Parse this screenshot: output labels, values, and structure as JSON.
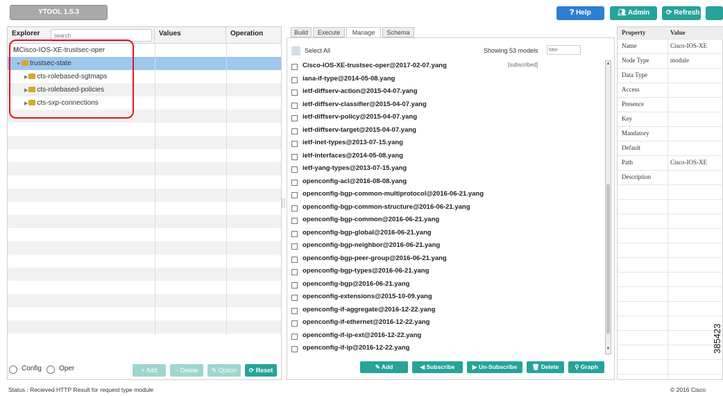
{
  "app": {
    "title": "YTOOL 1.5.3"
  },
  "toolbar": {
    "help": "Help",
    "admin": "Admin",
    "refresh": "Refresh"
  },
  "explorer": {
    "header": {
      "explorer": "Explorer",
      "search_placeholder": "search",
      "values": "Values",
      "operation": "Operation"
    },
    "tree": [
      {
        "label": "Cisco-IOS-XE-trustsec-oper"
      },
      {
        "label": "trustsec-state"
      },
      {
        "label": "cts-rolebased-sgtmaps"
      },
      {
        "label": "cts-rolebased-policies"
      },
      {
        "label": "cts-sxp-connections"
      }
    ],
    "footer": {
      "config": "Config",
      "oper": "Oper",
      "add": "Add",
      "delete": "Delete",
      "option": "Option",
      "reset": "Reset"
    }
  },
  "tabs": [
    "Build",
    "Execute",
    "Manage",
    "Schema"
  ],
  "manage": {
    "select_all": "Select All",
    "showing": "Showing 53 models",
    "filter_placeholder": "filter",
    "models": [
      {
        "name": "Cisco-IOS-XE-trustsec-oper@2017-02-07.yang",
        "tag": "[subscribed]"
      },
      {
        "name": "iana-if-type@2014-05-08.yang"
      },
      {
        "name": "ietf-diffserv-action@2015-04-07.yang"
      },
      {
        "name": "ietf-diffserv-classifier@2015-04-07.yang"
      },
      {
        "name": "ietf-diffserv-policy@2015-04-07.yang"
      },
      {
        "name": "ietf-diffserv-target@2015-04-07.yang"
      },
      {
        "name": "ietf-inet-types@2013-07-15.yang"
      },
      {
        "name": "ietf-interfaces@2014-05-08.yang"
      },
      {
        "name": "ietf-yang-types@2013-07-15.yang"
      },
      {
        "name": "openconfig-acl@2016-08-08.yang"
      },
      {
        "name": "openconfig-bgp-common-multiprotocol@2016-06-21.yang"
      },
      {
        "name": "openconfig-bgp-common-structure@2016-06-21.yang"
      },
      {
        "name": "openconfig-bgp-common@2016-06-21.yang"
      },
      {
        "name": "openconfig-bgp-global@2016-06-21.yang"
      },
      {
        "name": "openconfig-bgp-neighbor@2016-06-21.yang"
      },
      {
        "name": "openconfig-bgp-peer-group@2016-06-21.yang"
      },
      {
        "name": "openconfig-bgp-types@2016-06-21.yang"
      },
      {
        "name": "openconfig-bgp@2016-06-21.yang"
      },
      {
        "name": "openconfig-extensions@2015-10-09.yang"
      },
      {
        "name": "openconfig-if-aggregate@2016-12-22.yang"
      },
      {
        "name": "openconfig-if-ethernet@2016-12-22.yang"
      },
      {
        "name": "openconfig-if-ip-ext@2016-12-22.yang"
      },
      {
        "name": "openconfig-if-ip@2016-12-22.yang"
      }
    ],
    "buttons": {
      "add": "Add",
      "subscribe": "Subscribe",
      "unsubscribe": "Un-Subscribe",
      "delete": "Delete",
      "graph": "Graph"
    }
  },
  "properties": {
    "header": {
      "property": "Property",
      "value": "Value"
    },
    "rows": [
      {
        "key": "Name",
        "value": "Cisco-IOS-XE"
      },
      {
        "key": "Node Type",
        "value": "module"
      },
      {
        "key": "Data Type",
        "value": ""
      },
      {
        "key": "Access",
        "value": ""
      },
      {
        "key": "Presence",
        "value": ""
      },
      {
        "key": "Key",
        "value": ""
      },
      {
        "key": "Mandatory",
        "value": ""
      },
      {
        "key": "Default",
        "value": ""
      },
      {
        "key": "Path",
        "value": "Cisco-IOS-XE"
      },
      {
        "key": "Description",
        "value": ""
      }
    ]
  },
  "status": "Status : Recieved HTTP Result for request type module",
  "copyright": "© 2016 Cisco",
  "figure_number": "385423",
  "colors": {
    "accent": "#26a39a",
    "help": "#2f7fd1",
    "selection": "#9ec7ee",
    "highlight": "#e0141e"
  }
}
